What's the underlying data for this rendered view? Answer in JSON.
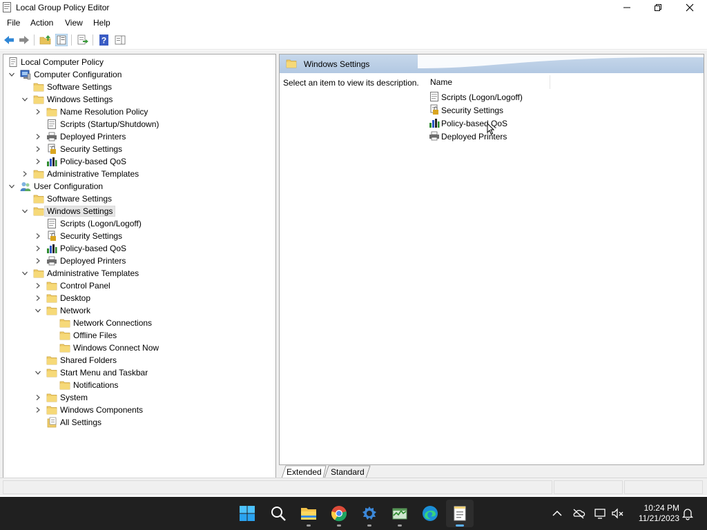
{
  "window": {
    "title": "Local Group Policy Editor"
  },
  "menubar": {
    "items": [
      "File",
      "Action",
      "View",
      "Help"
    ]
  },
  "tree": {
    "root": "Local Computer Policy",
    "computer_configuration": {
      "label": "Computer Configuration",
      "software_settings": "Software Settings",
      "windows_settings": "Windows Settings",
      "name_resolution_policy": "Name Resolution Policy",
      "scripts": "Scripts (Startup/Shutdown)",
      "deployed_printers": "Deployed Printers",
      "security_settings": "Security Settings",
      "policy_based_qos": "Policy-based QoS",
      "administrative_templates": "Administrative Templates"
    },
    "user_configuration": {
      "label": "User Configuration",
      "software_settings": "Software Settings",
      "windows_settings": "Windows Settings",
      "scripts": "Scripts (Logon/Logoff)",
      "security_settings": "Security Settings",
      "policy_based_qos": "Policy-based QoS",
      "deployed_printers": "Deployed Printers",
      "administrative_templates": "Administrative Templates",
      "control_panel": "Control Panel",
      "desktop": "Desktop",
      "network": "Network",
      "network_connections": "Network Connections",
      "offline_files": "Offline Files",
      "windows_connect_now": "Windows Connect Now",
      "shared_folders": "Shared Folders",
      "start_menu_taskbar": "Start Menu and Taskbar",
      "notifications": "Notifications",
      "system": "System",
      "windows_components": "Windows Components",
      "all_settings": "All Settings"
    }
  },
  "right_pane": {
    "header": "Windows Settings",
    "description": "Select an item to view its description.",
    "column_name": "Name",
    "items": [
      "Scripts (Logon/Logoff)",
      "Security Settings",
      "Policy-based QoS",
      "Deployed Printers"
    ],
    "tabs": [
      "Extended",
      "Standard"
    ]
  },
  "taskbar": {
    "clock_time": "10:24 PM",
    "clock_date": "11/21/2023"
  },
  "colors": {
    "header_band": "#b9cee6",
    "folder": "#e8c25a",
    "taskbar": "#202020",
    "selection": "#e5e5e5"
  }
}
